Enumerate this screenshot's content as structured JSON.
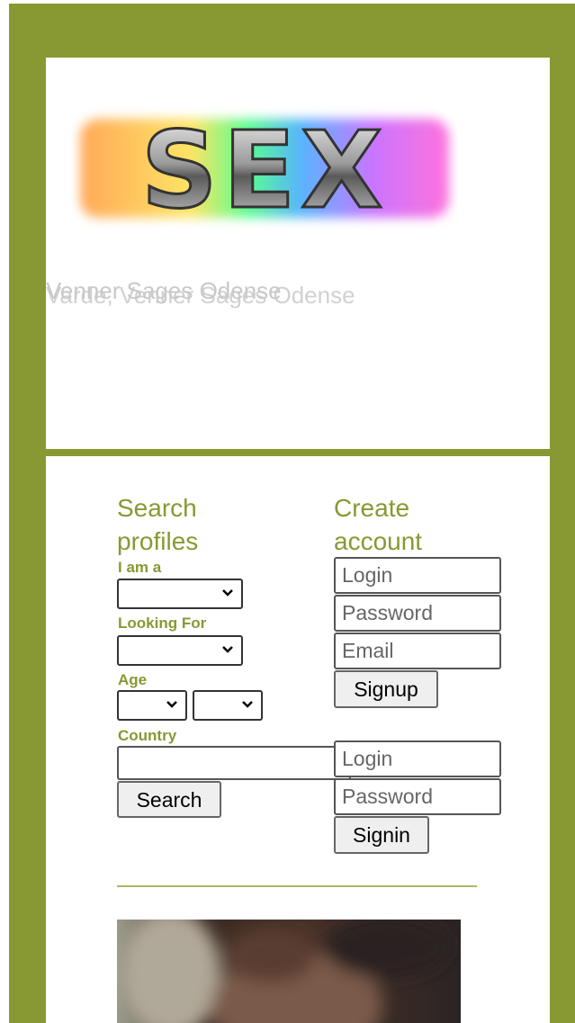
{
  "colors": {
    "frame": "#889933",
    "accent": "#889933",
    "tagline": "#c9c9c9"
  },
  "header": {
    "logo_text": "SEX",
    "tagline_primary": "Venner Sages Odense",
    "tagline_overlap": "Varde, Venner Sages Odense"
  },
  "search": {
    "title": "Search profiles",
    "i_am_label": "I am a",
    "i_am_value": "",
    "looking_for_label": "Looking For",
    "looking_for_value": "",
    "age_label": "Age",
    "age_min_value": "",
    "age_max_value": "",
    "country_label": "Country",
    "country_value": "",
    "search_button": "Search"
  },
  "signup": {
    "title": "Create account",
    "login_placeholder": "Login",
    "password_placeholder": "Password",
    "email_placeholder": "Email",
    "signup_button": "Signup"
  },
  "signin": {
    "login_placeholder": "Login",
    "password_placeholder": "Password",
    "signin_button": "Signin"
  },
  "icons": {
    "dropdown": "chevron-down-icon"
  }
}
